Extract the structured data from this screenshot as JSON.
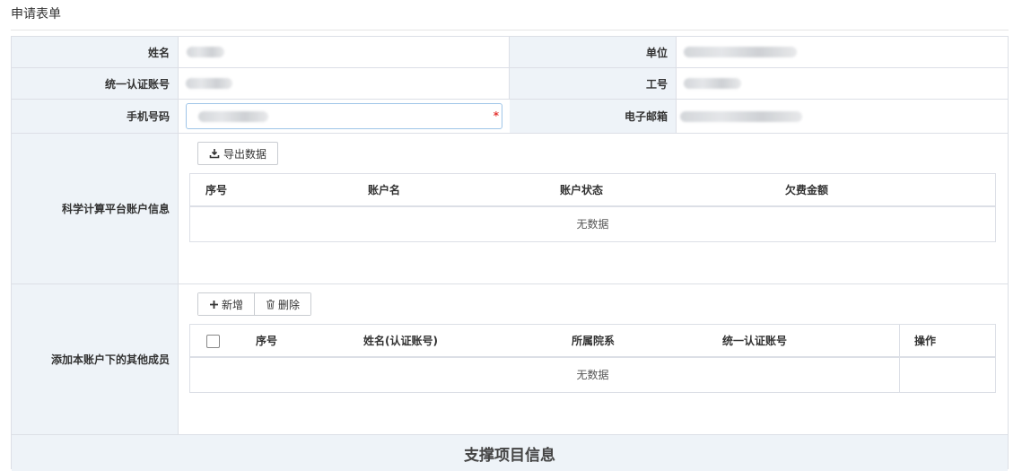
{
  "page": {
    "title": "申请表单"
  },
  "fields": {
    "name_label": "姓名",
    "unit_label": "单位",
    "uid_label": "统一认证账号",
    "job_no_label": "工号",
    "phone_label": "手机号码",
    "email_label": "电子邮箱",
    "required_mark": "*"
  },
  "accounts": {
    "section_label": "科学计算平台账户信息",
    "export_button": "导出数据",
    "columns": [
      "序号",
      "账户名",
      "账户状态",
      "欠费金额"
    ],
    "empty_text": "无数据"
  },
  "members": {
    "section_label": "添加本账户下的其他成员",
    "add_button": "新增",
    "delete_button": "删除",
    "columns": [
      "序号",
      "姓名(认证账号)",
      "所属院系",
      "统一认证账号",
      "操作"
    ],
    "empty_text": "无数据"
  },
  "project": {
    "section_title": "支撑项目信息"
  }
}
